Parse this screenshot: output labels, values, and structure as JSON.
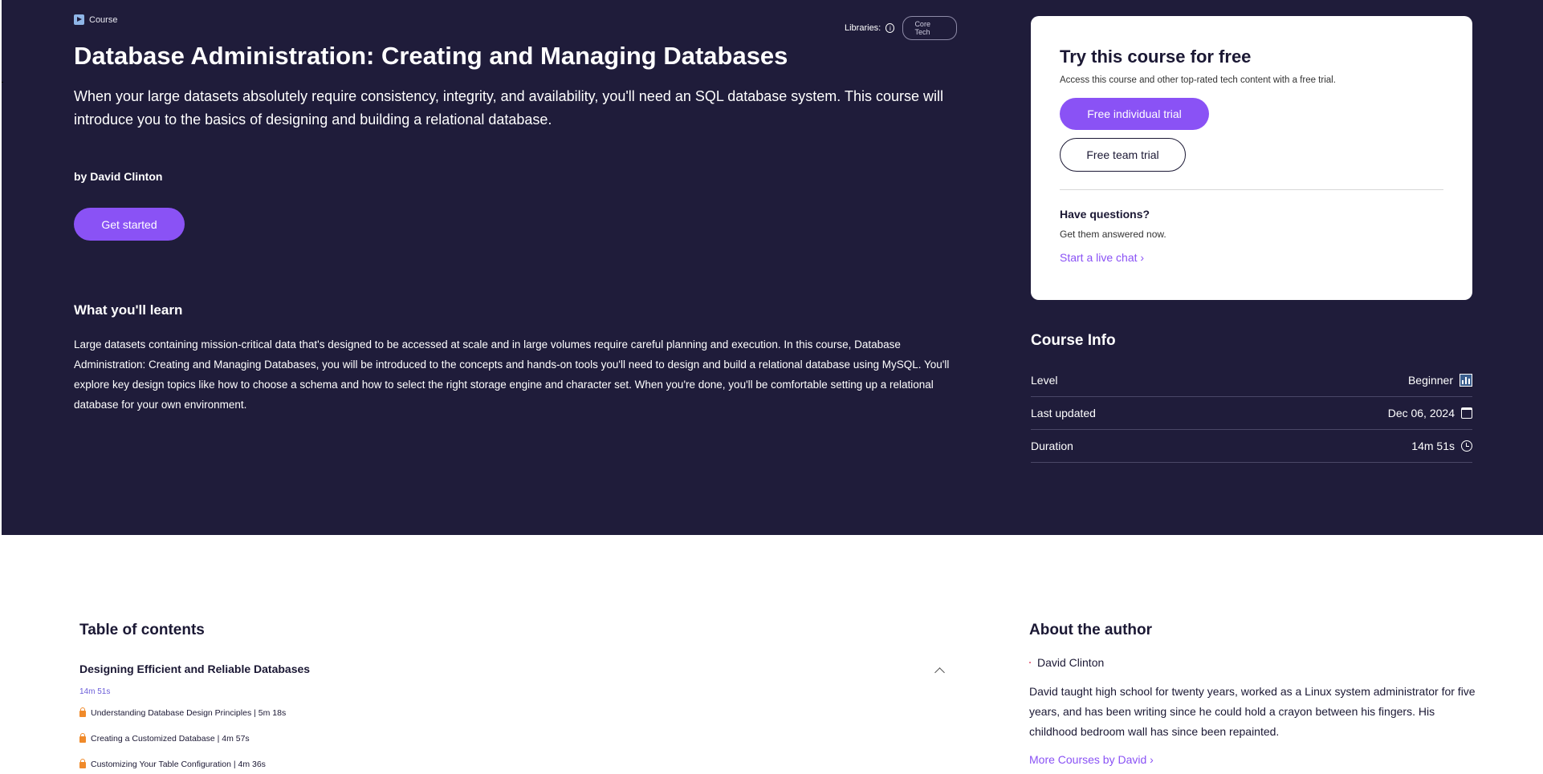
{
  "header": {
    "tag_label": "Course",
    "libraries_label": "Libraries:",
    "libraries_info": "i",
    "library_pill": "Core Tech"
  },
  "course": {
    "title": "Database Administration: Creating and Managing Databases",
    "subtitle": "When your large datasets absolutely require consistency, integrity, and availability, you'll need an SQL database system. This course will introduce you to the basics of designing and building a relational database.",
    "author_line": "by David Clinton",
    "cta_label": "Get started",
    "learn_heading": "What you'll learn",
    "learn_text": "Large datasets containing mission-critical data that's designed to be accessed at scale and in large volumes require careful planning and execution. In this course, Database Administration: Creating and Managing Databases, you will be introduced to the concepts and hands-on tools you'll need to design and build a relational database using MySQL. You'll explore key design topics like how to choose a schema and how to select the right storage engine and character set. When you're done, you'll be comfortable setting up a relational database for your own environment."
  },
  "trial_card": {
    "heading": "Try this course for free",
    "description": "Access this course and other top-rated tech content with a free trial.",
    "individual_label": "Free individual trial",
    "team_label": "Free team trial",
    "questions_heading": "Have questions?",
    "questions_sub": "Get them answered now.",
    "chat_label": "Start a live chat ›"
  },
  "course_info": {
    "heading": "Course Info",
    "rows": [
      {
        "label": "Level",
        "value": "Beginner",
        "icon": "bar-chart-icon"
      },
      {
        "label": "Last updated",
        "value": "Dec 06, 2024",
        "icon": "calendar-icon"
      },
      {
        "label": "Duration",
        "value": "14m 51s",
        "icon": "clock-icon"
      }
    ]
  },
  "toc": {
    "heading": "Table of contents",
    "section_title": "Designing Efficient and Reliable Databases",
    "section_duration": "14m 51s",
    "lessons": [
      "Understanding Database Design Principles | 5m 18s",
      "Creating a Customized Database | 4m 57s",
      "Customizing Your Table Configuration | 4m 36s"
    ]
  },
  "about": {
    "heading": "About the author",
    "name": "David Clinton",
    "bio": "David taught high school for twenty years, worked as a Linux system administrator for five years, and has been writing since he could hold a crayon between his fingers. His childhood bedroom wall has since been repainted.",
    "more_label": "More Courses by David ›"
  },
  "colors": {
    "hero_bg": "#1f1c3a",
    "accent": "#8a52f5",
    "lock": "#f08a2a"
  }
}
